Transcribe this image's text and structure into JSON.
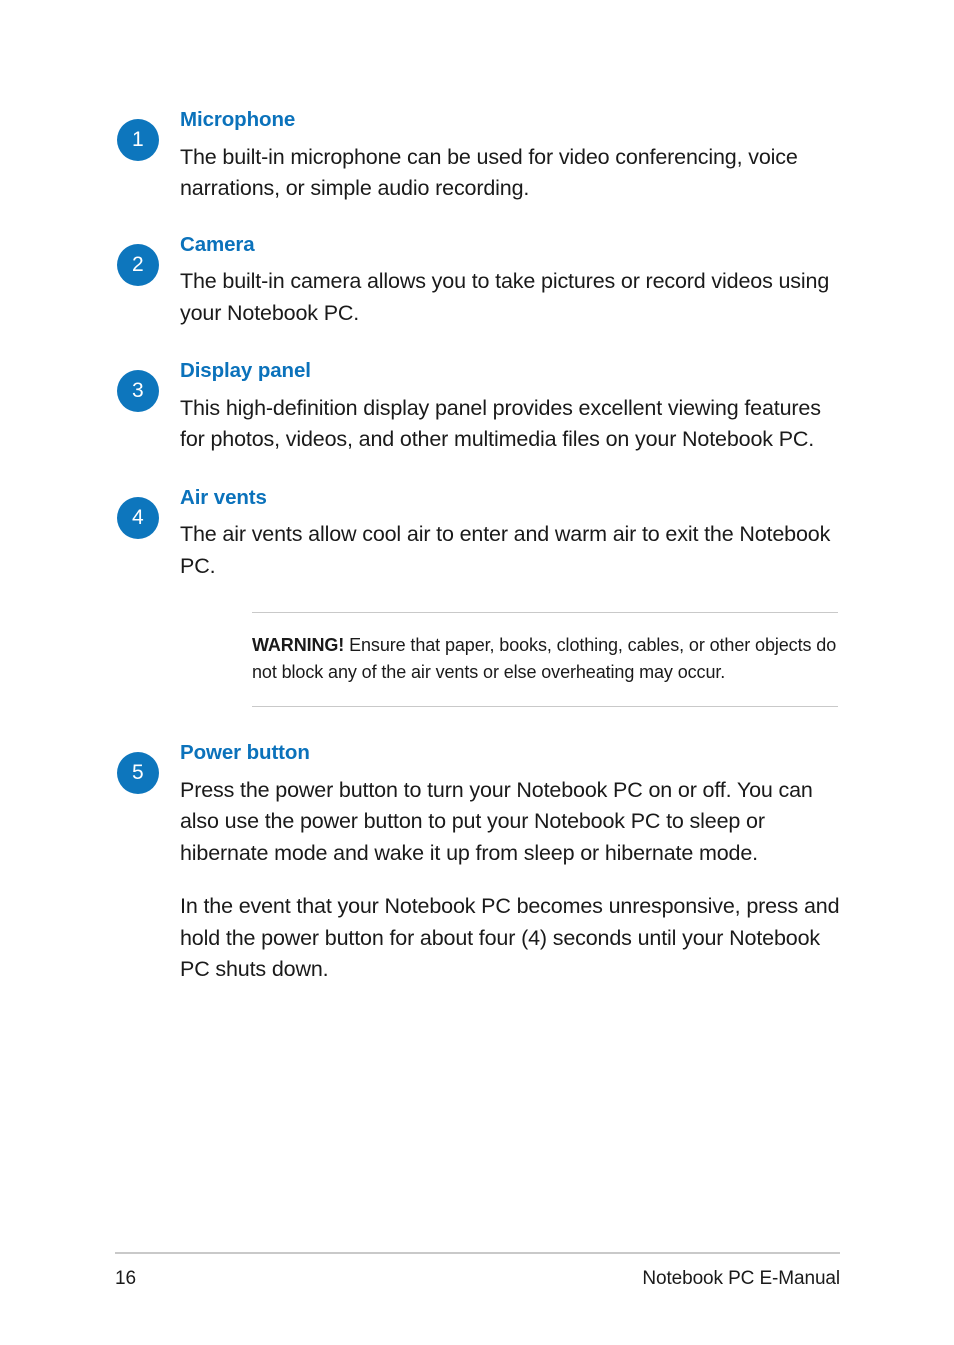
{
  "document": {
    "title": "Notebook PC E-Manual",
    "page_number": "16"
  },
  "items": [
    {
      "number": "1",
      "title": "Microphone",
      "paragraphs": [
        "The built-in microphone can be used for video conferencing, voice narrations, or simple audio recording."
      ]
    },
    {
      "number": "2",
      "title": "Camera",
      "paragraphs": [
        "The built-in camera allows you to take pictures or record videos using your Notebook PC."
      ]
    },
    {
      "number": "3",
      "title": "Display panel",
      "paragraphs": [
        "This high-definition display panel provides excellent viewing features for photos, videos, and other multimedia files on your Notebook PC."
      ]
    },
    {
      "number": "4",
      "title": "Air vents",
      "paragraphs": [
        "The air vents allow cool air to enter and warm air to exit the Notebook PC."
      ]
    },
    {
      "number": "5",
      "title": "Power button",
      "paragraphs": [
        "Press the power button to turn your Notebook PC on or off. You can also use the power button to put your Notebook PC to sleep or hibernate mode and wake it up from sleep or hibernate mode.",
        "In the event that your Notebook PC becomes unresponsive, press and hold the power button for about four (4) seconds until your Notebook PC shuts down."
      ]
    }
  ],
  "callout": {
    "lead": "WARNING!",
    "text": " Ensure that paper, books, clothing, cables, or other objects do not block any of the air vents or else overheating may occur."
  },
  "footer": {
    "page_number": "16",
    "manual_title": "Notebook PC E-Manual"
  },
  "colors": {
    "accent_blue": "#0b72bb",
    "badge_blue": "#0d76bd",
    "body_text": "#1a1a1a",
    "rule_gray": "#c9c9c9",
    "background": "#ffffff"
  }
}
